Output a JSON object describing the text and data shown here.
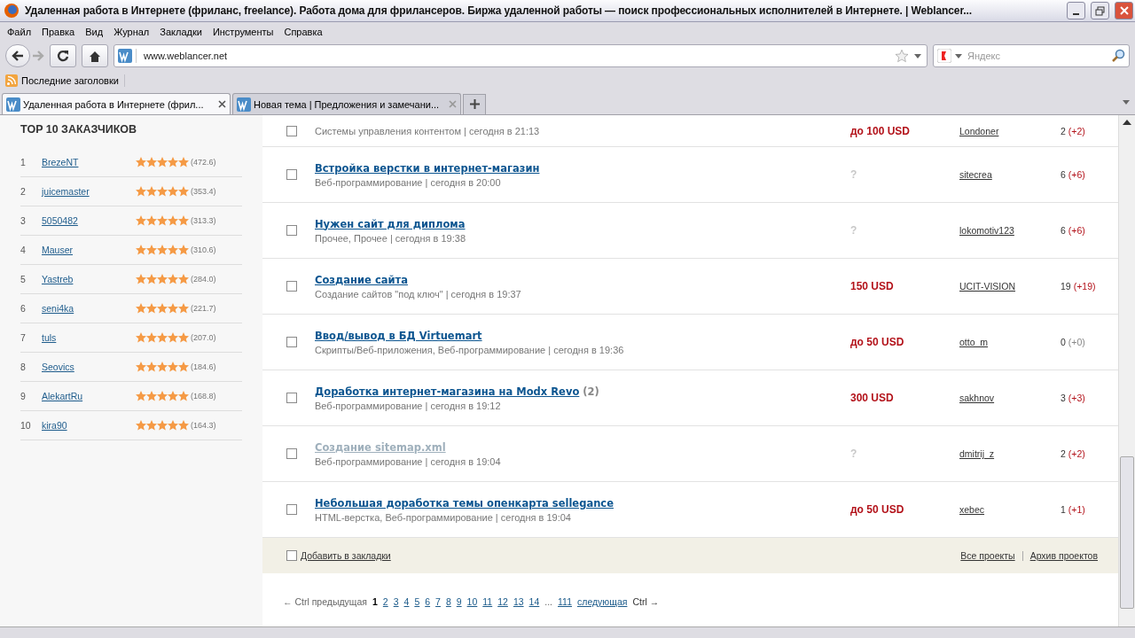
{
  "window": {
    "title": "Удаленная работа в Интернете (фриланс, freelance). Работа дома для фрилансеров. Биржа удаленной работы — поиск профессиональных исполнителей в Интернете. | Weblancer..."
  },
  "menu": [
    "Файл",
    "Правка",
    "Вид",
    "Журнал",
    "Закладки",
    "Инструменты",
    "Справка"
  ],
  "address": {
    "value": "www.weblancer.net"
  },
  "search": {
    "placeholder": "Яндекс"
  },
  "bookmarks": [
    "Последние заголовки"
  ],
  "tabs": [
    {
      "label": "Удаленная работа в Интернете (фрил...",
      "selected": true
    },
    {
      "label": "Новая тема | Предложения и замечани...",
      "selected": false
    }
  ],
  "sidebar": {
    "title": "TOP 10 ЗАКАЗЧИКОВ",
    "items": [
      {
        "rank": "1",
        "name": "BrezeNT",
        "stars": 5,
        "score": "(472.6)"
      },
      {
        "rank": "2",
        "name": "juicemaster",
        "stars": 5,
        "score": "(353.4)"
      },
      {
        "rank": "3",
        "name": "5050482",
        "stars": 5,
        "score": "(313.3)"
      },
      {
        "rank": "4",
        "name": "Mauser",
        "stars": 5,
        "score": "(310.6)"
      },
      {
        "rank": "5",
        "name": "Yastreb",
        "stars": 5,
        "score": "(284.0)"
      },
      {
        "rank": "6",
        "name": "seni4ka",
        "stars": 5,
        "score": "(221.7)"
      },
      {
        "rank": "7",
        "name": "tuls",
        "stars": 5,
        "score": "(207.0)"
      },
      {
        "rank": "8",
        "name": "Seovics",
        "stars": 5,
        "score": "(184.6)"
      },
      {
        "rank": "9",
        "name": "AlekartRu",
        "stars": 5,
        "score": "(168.8)"
      },
      {
        "rank": "10",
        "name": "kira90",
        "stars": 5,
        "score": "(164.3)"
      }
    ]
  },
  "projects": [
    {
      "checked": false,
      "meta": "Системы управления контентом | сегодня в 21:13",
      "kind": "price",
      "price": "до 100 USD",
      "author": "Londoner",
      "count": "2",
      "delta": "(+2)",
      "new": true
    },
    {
      "title": "Встройка верстки в интернет-магазин",
      "checked": false,
      "visited": false,
      "meta": "Веб-программирование | сегодня в 20:00",
      "kind": "unknown",
      "price": "?",
      "author": "sitecrea",
      "count": "6",
      "delta": "(+6)",
      "new": true
    },
    {
      "title": "Нужен сайт для диплома",
      "checked": false,
      "visited": false,
      "meta": "Прочее, Прочее | сегодня в 19:38",
      "kind": "unknown",
      "price": "?",
      "author": "lokomotiv123",
      "count": "6",
      "delta": "(+6)",
      "new": true
    },
    {
      "title": "Создание сайта",
      "checked": false,
      "visited": false,
      "meta": "Создание сайтов \"под ключ\" | сегодня в 19:37",
      "kind": "price",
      "price": "150 USD",
      "author": "UCIT-VISION",
      "count": "19",
      "delta": "(+19)",
      "new": true
    },
    {
      "title": "Ввод/вывод в БД Virtuemart",
      "checked": false,
      "visited": false,
      "meta": "Скрипты/Веб-приложения, Веб-программирование | сегодня в 19:36",
      "kind": "price",
      "price": "до 50 USD",
      "author": "otto_m",
      "count": "0",
      "delta": "(+0)",
      "new": false
    },
    {
      "title": "Доработка интернет-магазина на Modx Revo",
      "extra": "(2)",
      "checked": false,
      "visited": false,
      "meta": "Веб-программирование | сегодня в 19:12",
      "kind": "price",
      "price": "300 USD",
      "author": "sakhnov",
      "count": "3",
      "delta": "(+3)",
      "new": true
    },
    {
      "title": "Создание sitemap.xml",
      "checked": false,
      "visited": true,
      "meta": "Веб-программирование | сегодня в 19:04",
      "kind": "unknown",
      "price": "?",
      "author": "dmitrij_z",
      "count": "2",
      "delta": "(+2)",
      "new": true
    },
    {
      "title": "Небольшая доработка темы опенкарта sellegance",
      "checked": false,
      "visited": false,
      "meta": "HTML-верстка, Веб-программирование | сегодня в 19:04",
      "kind": "price",
      "price": "до 50 USD",
      "author": "xebec",
      "count": "1",
      "delta": "(+1)",
      "new": true
    }
  ],
  "footer": {
    "bookmark": {
      "label": "Добавить в закладки",
      "checked": false
    },
    "links": [
      "Все проекты",
      "Архив проектов"
    ]
  },
  "pagination": {
    "prev": "← Ctrl предыдущая",
    "pages": [
      {
        "label": "1",
        "selected": true
      },
      {
        "label": "2",
        "selected": false
      },
      {
        "label": "3",
        "selected": false
      },
      {
        "label": "4",
        "selected": false
      },
      {
        "label": "5",
        "selected": false
      },
      {
        "label": "6",
        "selected": false
      },
      {
        "label": "7",
        "selected": false
      },
      {
        "label": "8",
        "selected": false
      },
      {
        "label": "9",
        "selected": false
      },
      {
        "label": "10",
        "selected": false
      },
      {
        "label": "11",
        "selected": false
      },
      {
        "label": "12",
        "selected": false
      },
      {
        "label": "13",
        "selected": false
      },
      {
        "label": "14",
        "selected": false
      }
    ],
    "ellipsis": "...",
    "last": "111",
    "next": "следующая",
    "next_hint": "Ctrl →"
  }
}
